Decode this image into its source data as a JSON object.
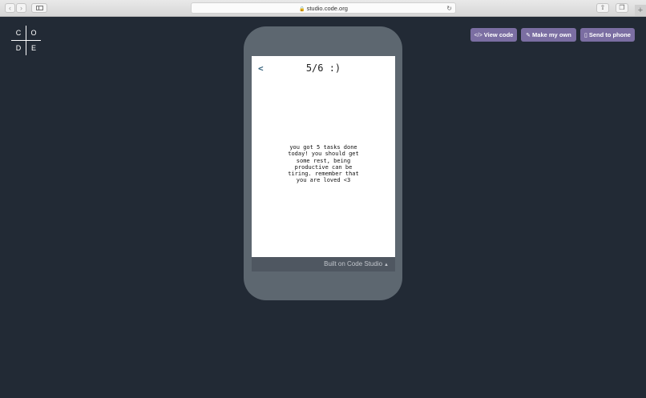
{
  "browser": {
    "back_icon": "chevron-left-icon",
    "forward_icon": "chevron-right-icon",
    "url": "studio.code.org",
    "lock_icon": "lock-icon",
    "reload_icon": "reload-icon",
    "share_icon": "share-icon",
    "tabs_icon": "tabs-icon",
    "new_tab_icon": "plus-icon"
  },
  "logo": {
    "letters": [
      "C",
      "O",
      "D",
      "E"
    ]
  },
  "actions": {
    "view_code": "View code",
    "make_my_own": "Make my own",
    "send_to_phone": "Send to phone"
  },
  "app": {
    "back": "<",
    "title": "5/6 :)",
    "message_lines": [
      "you got 5 tasks done",
      "today! you should get",
      "some rest, being",
      "productive can be",
      "tiring. remember that",
      "you are loved <3"
    ],
    "footer": "Built on Code Studio"
  },
  "colors": {
    "page_bg": "#222a35",
    "phone_frame": "#5d6770",
    "button_purple": "#7b6ea2",
    "footer_bar": "#4f5761"
  }
}
